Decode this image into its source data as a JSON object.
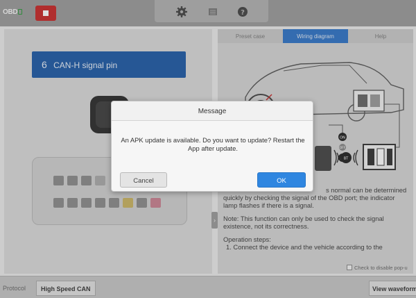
{
  "topbar": {
    "logo_text": "OBD",
    "stop_icon": "stop-icon",
    "tools": [
      {
        "name": "settings",
        "icon": "gear-icon"
      },
      {
        "name": "document",
        "icon": "document-icon"
      },
      {
        "name": "help",
        "icon": "help-icon"
      }
    ]
  },
  "left_panel": {
    "pin_number": "6",
    "pin_label": "CAN-H signal pin"
  },
  "right_panel": {
    "tabs": [
      {
        "label": "Preset case",
        "active": false
      },
      {
        "label": "Wiring diagram",
        "active": true
      },
      {
        "label": "Help",
        "active": false
      }
    ],
    "diagram_labels": {
      "on": "ON",
      "off": "OFF",
      "bt": "BT"
    },
    "description_1": "... is normal can be determined quickly by checking the signal of the OBD port; the indicator lamp flashes if there is a signal.",
    "description_1_visible_prefix": "s normal can be determined",
    "description_1_rest": "quickly by checking the signal of the OBD port; the indicator lamp flashes if there is a signal.",
    "note": "Note: This function can only be used to check the signal existence, not its correctness.",
    "steps_heading": "Operation steps:",
    "step_1": "1. Connect the device and the vehicle according to the",
    "checkbox_label": "Check to disable pop-u"
  },
  "bottom_bar": {
    "protocol_label": "Protocol",
    "protocol_value": "High Speed CAN",
    "view_waveform": "View waveform"
  },
  "dialog": {
    "title": "Message",
    "message": "An APK update is available. Do you want to update? Restart the App after update.",
    "cancel_label": "Cancel",
    "ok_label": "OK"
  },
  "colors": {
    "accent_blue": "#2f73c6",
    "pin_button": "#1e5aa5",
    "stop_red": "#c62828",
    "ok_button": "#2f86e0"
  }
}
